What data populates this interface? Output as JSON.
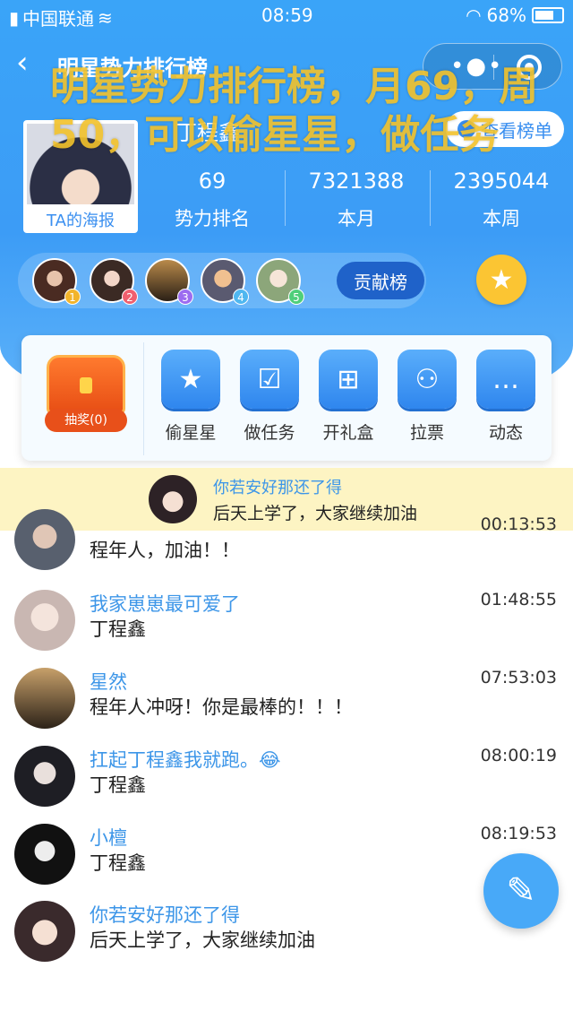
{
  "status_bar": {
    "carrier": "中国联通",
    "time": "08:59",
    "battery": "68%"
  },
  "nav": {
    "title": "明星势力排行榜"
  },
  "profile": {
    "name": "丁程鑫",
    "poster_label": "TA的海报",
    "rank_link_label": "查看榜单",
    "stats": [
      {
        "value": "69",
        "label": "势力排名"
      },
      {
        "value": "7321388",
        "label": "本月"
      },
      {
        "value": "2395044",
        "label": "本周"
      }
    ]
  },
  "fans": {
    "ranks": [
      "1",
      "2",
      "3",
      "4",
      "5"
    ],
    "button_label": "贡献榜"
  },
  "actions": {
    "lottery_label": "抽奖(0)",
    "items": [
      {
        "label": "偷星星",
        "icon": "star-icon"
      },
      {
        "label": "做任务",
        "icon": "task-icon"
      },
      {
        "label": "开礼盒",
        "icon": "gift-icon"
      },
      {
        "label": "拉票",
        "icon": "users-icon"
      },
      {
        "label": "动态",
        "icon": "chat-icon"
      }
    ]
  },
  "notice": {
    "name": "你若安好那还了得",
    "message": "后天上学了，大家继续加油"
  },
  "feed": [
    {
      "name": "",
      "message": "程年人，加油！！",
      "time": "00:13:53"
    },
    {
      "name": "我家崽崽最可爱了",
      "message": "丁程鑫",
      "time": "01:48:55"
    },
    {
      "name": "星然",
      "message": "程年人冲呀！你是最棒的！！！",
      "time": "07:53:03"
    },
    {
      "name": "扛起丁程鑫我就跑。😂",
      "message": "丁程鑫",
      "time": "08:00:19"
    },
    {
      "name": "小檀",
      "message": "丁程鑫",
      "time": "08:19:53"
    },
    {
      "name": "你若安好那还了得",
      "message": "后天上学了，大家继续加油",
      "time": ""
    }
  ],
  "overlay_text": "明星势力排行榜，月69，周50，可以偷星星，做任务",
  "colors": {
    "primary": "#3aa4f8",
    "accent": "#fbc533",
    "link": "#3d96e8"
  }
}
